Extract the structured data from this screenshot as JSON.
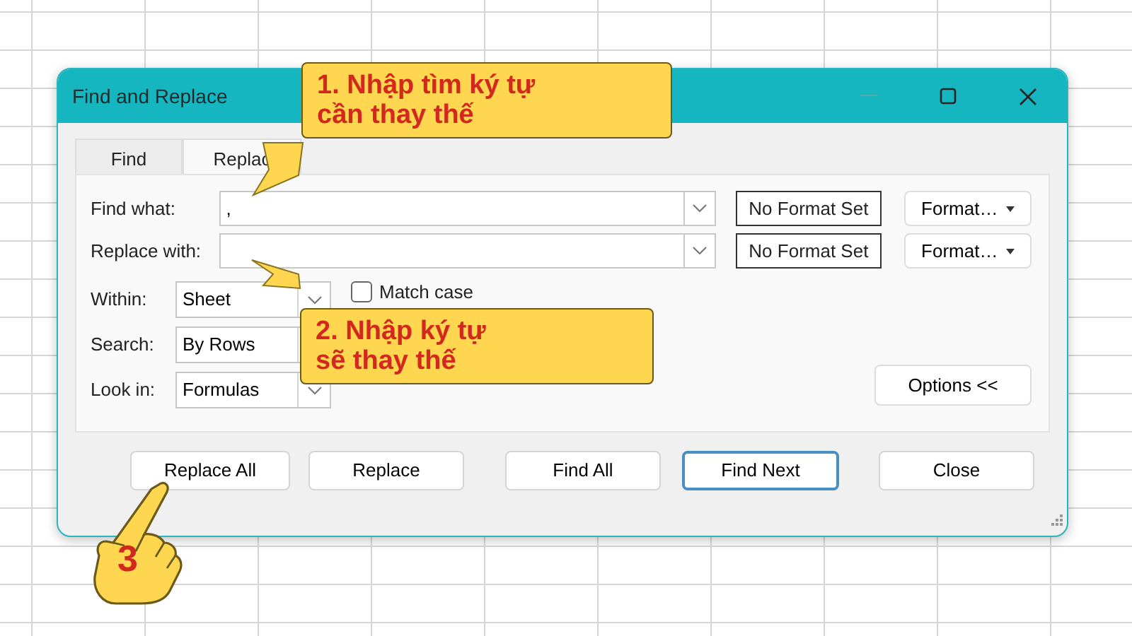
{
  "window": {
    "title": "Find and Replace"
  },
  "tabs": [
    {
      "label": "Find",
      "selected": false
    },
    {
      "label": "Replac",
      "selected": true
    }
  ],
  "fields": [
    {
      "label": "Find what:",
      "value": ",",
      "format_status": "No Format Set",
      "format_button": "Format…"
    },
    {
      "label": "Replace with:",
      "format_status": "No Format Set",
      "format_button": "Format…"
    }
  ],
  "selects": [
    {
      "label": "Within:",
      "value": "Sheet"
    },
    {
      "label": "Search:",
      "value": "By Rows"
    },
    {
      "label": "Look in:",
      "value": "Formulas"
    }
  ],
  "match_case": {
    "label": "Match case",
    "checked": false
  },
  "options_button": "Options <<",
  "buttons": [
    {
      "label": "Replace All",
      "focused": false
    },
    {
      "label": "Replace",
      "focused": false
    },
    {
      "label": "Find All",
      "focused": false
    },
    {
      "label": "Find Next",
      "focused": true
    },
    {
      "label": "Close",
      "focused": false
    }
  ],
  "callouts": [
    {
      "lines": [
        "1. Nhập tìm ký tự",
        "cần thay thế"
      ]
    },
    {
      "lines": [
        "2. Nhập ký tự",
        "sẽ thay thế"
      ]
    }
  ],
  "step_badge": "3"
}
